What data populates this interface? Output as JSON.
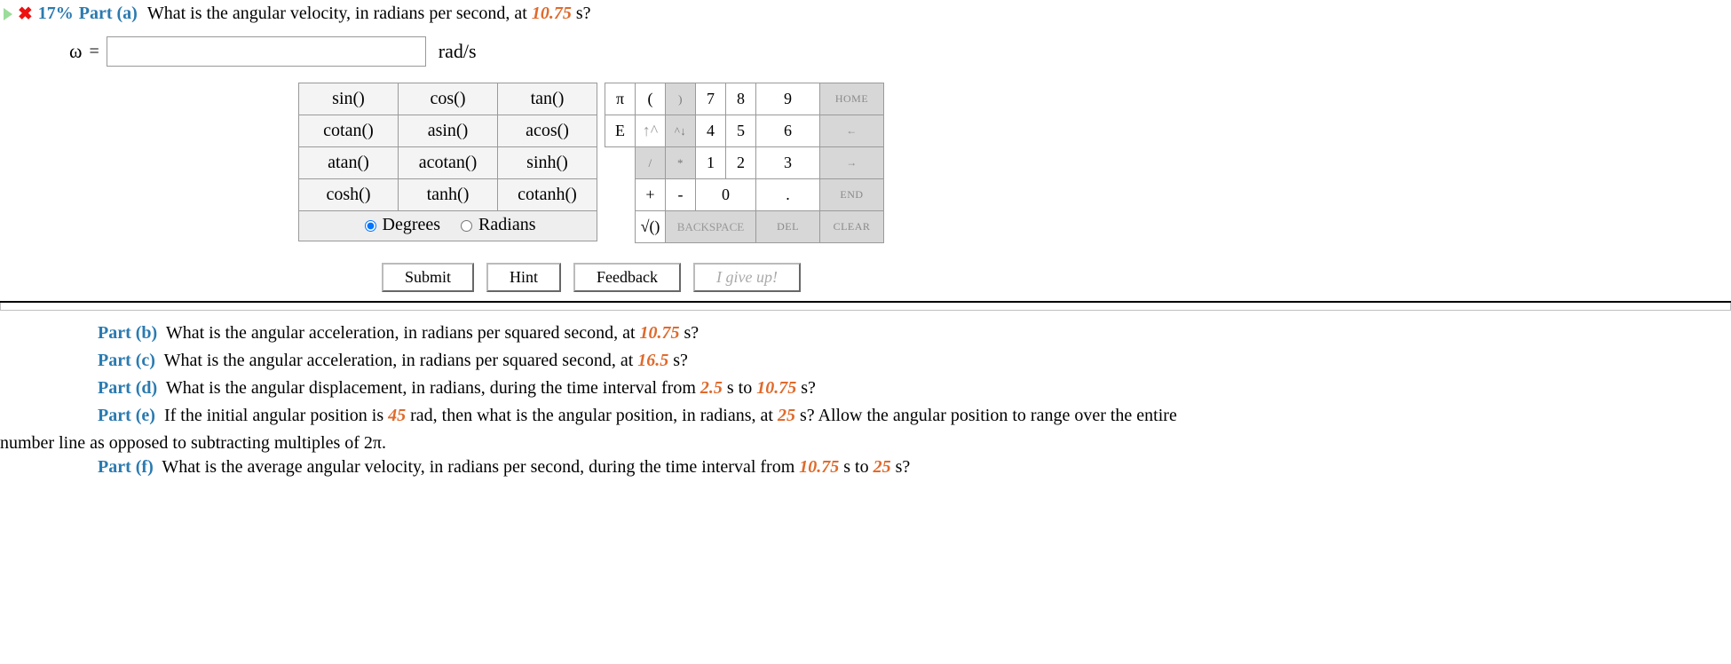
{
  "partA": {
    "percent": "17%",
    "label": "Part (a)",
    "q_pre": "What is the angular velocity, in radians per second, at ",
    "time": "10.75",
    "q_post": " s?",
    "omega": "ω",
    "eq": "=",
    "unit": "rad/s",
    "value": ""
  },
  "funcs": {
    "r1c1": "sin()",
    "r1c2": "cos()",
    "r1c3": "tan()",
    "r2c1": "cotan()",
    "r2c2": "asin()",
    "r2c3": "acos()",
    "r3c1": "atan()",
    "r3c2": "acotan()",
    "r3c3": "sinh()",
    "r4c1": "cosh()",
    "r4c2": "tanh()",
    "r4c3": "cotanh()",
    "modeDeg": "Degrees",
    "modeRad": "Radians"
  },
  "keys": {
    "pi": "π",
    "lp": "(",
    "rp": ")",
    "n7": "7",
    "n8": "8",
    "n9": "9",
    "home": "HOME",
    "E": "E",
    "cu": "↑^",
    "cd": "^↓",
    "n4": "4",
    "n5": "5",
    "n6": "6",
    "left": "←",
    "slash": "/",
    "star": "*",
    "n1": "1",
    "n2": "2",
    "n3": "3",
    "right": "→",
    "plus": "+",
    "minus": "-",
    "n0": "0",
    "dot": ".",
    "end": "END",
    "sqrt": "√()",
    "back": "BACKSPACE",
    "del": "DEL",
    "clear": "CLEAR"
  },
  "actions": {
    "submit": "Submit",
    "hint": "Hint",
    "feedback": "Feedback",
    "giveup": "I give up!"
  },
  "parts": {
    "b": {
      "label": "Part (b)",
      "pre": "What is the angular acceleration, in radians per squared second, at ",
      "val": "10.75",
      "post": " s?"
    },
    "c": {
      "label": "Part (c)",
      "pre": "What is the angular acceleration, in radians per squared second, at ",
      "val": "16.5",
      "post": " s?"
    },
    "d": {
      "label": "Part (d)",
      "pre": "What is the angular displacement, in radians, during the time interval from ",
      "val1": "2.5",
      "mid": " s to ",
      "val2": "10.75",
      "post": " s?"
    },
    "e": {
      "label": "Part (e)",
      "pre": "If the initial angular position is ",
      "val1": "45",
      "mid1": " rad, then what is the angular position, in radians, at ",
      "val2": "25",
      "mid2": " s? Allow the angular position to range over the entire",
      "cont": "number line as opposed to subtracting multiples of 2π."
    },
    "f": {
      "label": "Part (f)",
      "pre": "What is the average angular velocity, in radians per second, during the time interval from ",
      "val1": "10.75",
      "mid": " s to ",
      "val2": "25",
      "post": " s?"
    }
  }
}
